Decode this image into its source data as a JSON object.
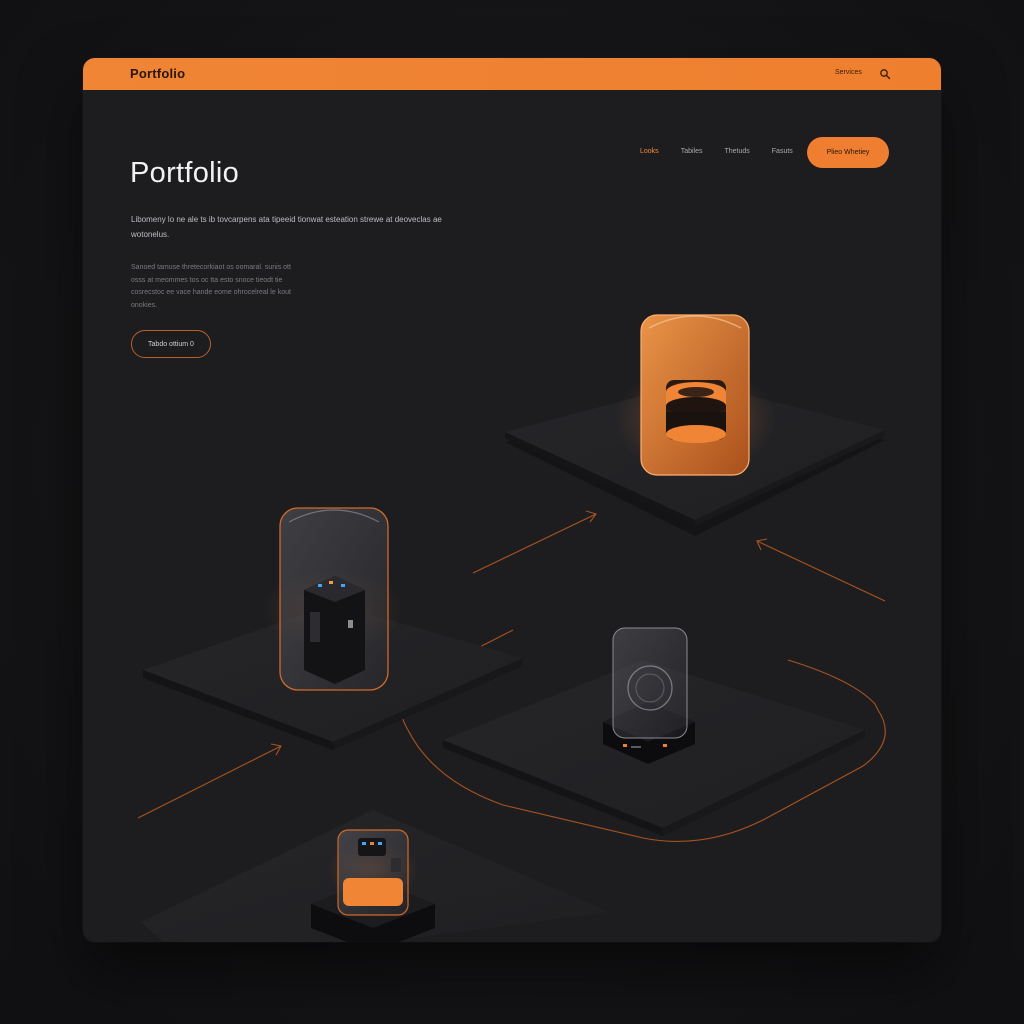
{
  "topbar": {
    "brand": "Portfolio",
    "link": "Services",
    "search_icon": "search-icon"
  },
  "header": {
    "title": "Portfolio",
    "nav": [
      "Looks",
      "Tabiles",
      "Thetuds",
      "Fasuts"
    ],
    "cta_label": "Plieo   Whetiey"
  },
  "intro": {
    "lead": "Libomeny lo ne ale ts ib tovcarpens ata tipeeid tionwat esteation strewe at deoveclas ae wotonelus.",
    "body": "Sanoed tamuse thretecorkiaot os oomaral. sunis ott osss at meommes tos oc tta esto snoce tieodt tie cosrecstoc ee vace hande eome ohrocelreal le kout onokies.",
    "button_label": "Tabdo ottium 0"
  },
  "colors": {
    "accent": "#ef7e30",
    "background": "#1d1d20",
    "platform": "#232326"
  }
}
